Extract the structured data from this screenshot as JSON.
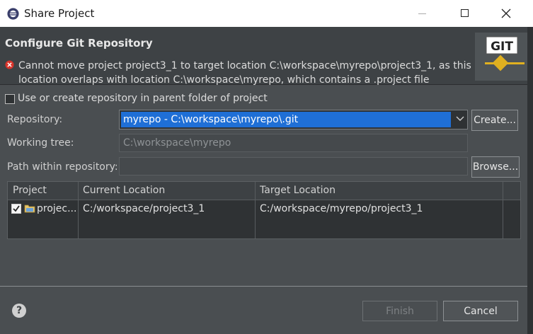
{
  "window": {
    "title": "Share Project"
  },
  "header": {
    "title": "Configure Git Repository",
    "message": "Cannot move project project3_1 to target location C:\\workspace\\myrepo\\project3_1, as this location overlaps with location C:\\workspace\\myrepo, which contains a .project file",
    "logo_text": "GIT"
  },
  "options": {
    "use_parent_label": "Use or create repository in parent folder of project",
    "use_parent_checked": false
  },
  "form": {
    "repository_label": "Repository:",
    "repository_value": "myrepo - C:\\workspace\\myrepo\\.git",
    "create_button": "Create...",
    "working_tree_label": "Working tree:",
    "working_tree_value": "C:\\workspace\\myrepo",
    "path_label": "Path within repository:",
    "path_value": "",
    "browse_button": "Browse..."
  },
  "table": {
    "columns": [
      "Project",
      "Current Location",
      "Target Location"
    ],
    "rows": [
      {
        "checked": true,
        "project": "projec...",
        "current": "C:/workspace/project3_1",
        "target": "C:/workspace/myrepo/project3_1"
      }
    ]
  },
  "footer": {
    "finish_button": "Finish",
    "cancel_button": "Cancel",
    "help_symbol": "?"
  },
  "colors": {
    "selection": "#1f6fd6",
    "error": "#d9342b",
    "background": "#4a4e51"
  }
}
